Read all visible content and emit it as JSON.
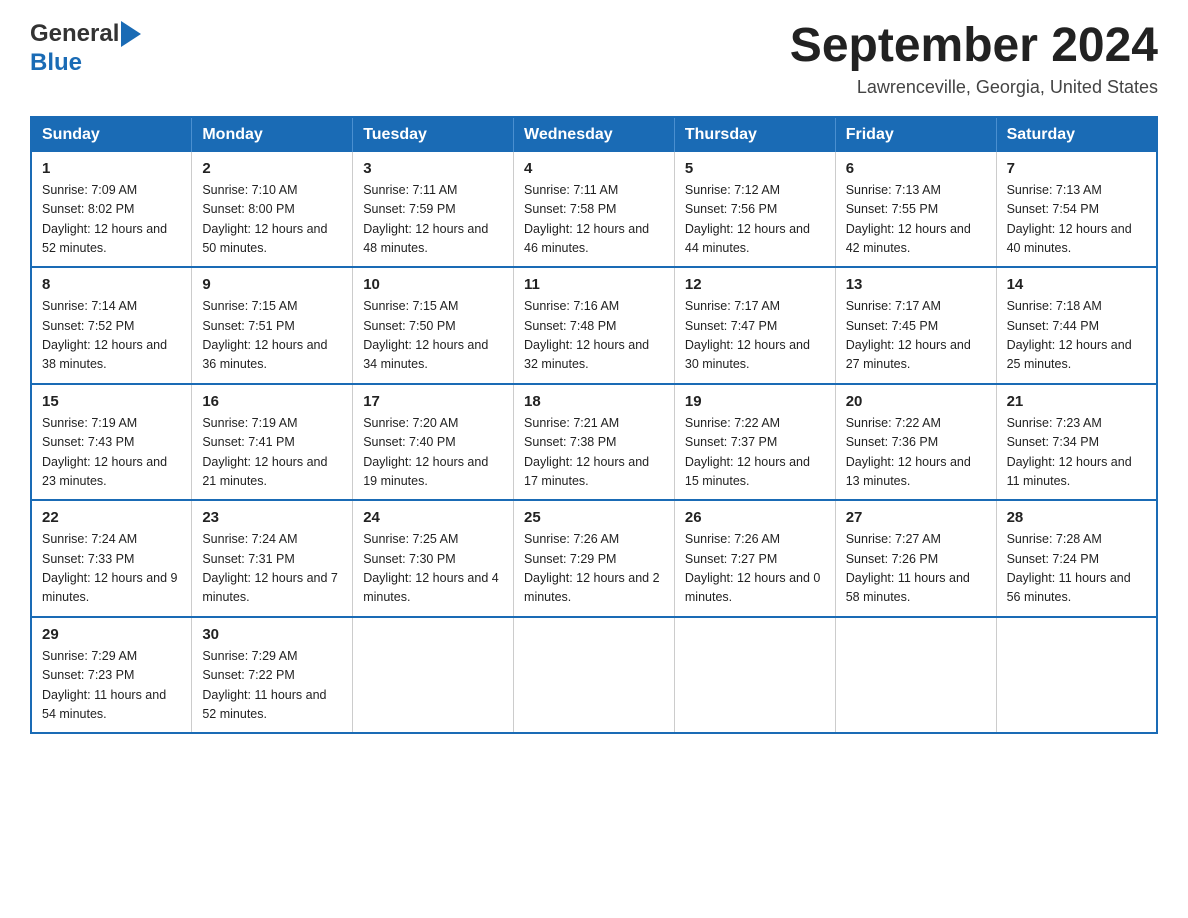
{
  "header": {
    "logo_general": "General",
    "logo_blue": "Blue",
    "title": "September 2024",
    "location": "Lawrenceville, Georgia, United States"
  },
  "weekdays": [
    "Sunday",
    "Monday",
    "Tuesday",
    "Wednesday",
    "Thursday",
    "Friday",
    "Saturday"
  ],
  "weeks": [
    [
      {
        "day": "1",
        "sunrise": "Sunrise: 7:09 AM",
        "sunset": "Sunset: 8:02 PM",
        "daylight": "Daylight: 12 hours and 52 minutes."
      },
      {
        "day": "2",
        "sunrise": "Sunrise: 7:10 AM",
        "sunset": "Sunset: 8:00 PM",
        "daylight": "Daylight: 12 hours and 50 minutes."
      },
      {
        "day": "3",
        "sunrise": "Sunrise: 7:11 AM",
        "sunset": "Sunset: 7:59 PM",
        "daylight": "Daylight: 12 hours and 48 minutes."
      },
      {
        "day": "4",
        "sunrise": "Sunrise: 7:11 AM",
        "sunset": "Sunset: 7:58 PM",
        "daylight": "Daylight: 12 hours and 46 minutes."
      },
      {
        "day": "5",
        "sunrise": "Sunrise: 7:12 AM",
        "sunset": "Sunset: 7:56 PM",
        "daylight": "Daylight: 12 hours and 44 minutes."
      },
      {
        "day": "6",
        "sunrise": "Sunrise: 7:13 AM",
        "sunset": "Sunset: 7:55 PM",
        "daylight": "Daylight: 12 hours and 42 minutes."
      },
      {
        "day": "7",
        "sunrise": "Sunrise: 7:13 AM",
        "sunset": "Sunset: 7:54 PM",
        "daylight": "Daylight: 12 hours and 40 minutes."
      }
    ],
    [
      {
        "day": "8",
        "sunrise": "Sunrise: 7:14 AM",
        "sunset": "Sunset: 7:52 PM",
        "daylight": "Daylight: 12 hours and 38 minutes."
      },
      {
        "day": "9",
        "sunrise": "Sunrise: 7:15 AM",
        "sunset": "Sunset: 7:51 PM",
        "daylight": "Daylight: 12 hours and 36 minutes."
      },
      {
        "day": "10",
        "sunrise": "Sunrise: 7:15 AM",
        "sunset": "Sunset: 7:50 PM",
        "daylight": "Daylight: 12 hours and 34 minutes."
      },
      {
        "day": "11",
        "sunrise": "Sunrise: 7:16 AM",
        "sunset": "Sunset: 7:48 PM",
        "daylight": "Daylight: 12 hours and 32 minutes."
      },
      {
        "day": "12",
        "sunrise": "Sunrise: 7:17 AM",
        "sunset": "Sunset: 7:47 PM",
        "daylight": "Daylight: 12 hours and 30 minutes."
      },
      {
        "day": "13",
        "sunrise": "Sunrise: 7:17 AM",
        "sunset": "Sunset: 7:45 PM",
        "daylight": "Daylight: 12 hours and 27 minutes."
      },
      {
        "day": "14",
        "sunrise": "Sunrise: 7:18 AM",
        "sunset": "Sunset: 7:44 PM",
        "daylight": "Daylight: 12 hours and 25 minutes."
      }
    ],
    [
      {
        "day": "15",
        "sunrise": "Sunrise: 7:19 AM",
        "sunset": "Sunset: 7:43 PM",
        "daylight": "Daylight: 12 hours and 23 minutes."
      },
      {
        "day": "16",
        "sunrise": "Sunrise: 7:19 AM",
        "sunset": "Sunset: 7:41 PM",
        "daylight": "Daylight: 12 hours and 21 minutes."
      },
      {
        "day": "17",
        "sunrise": "Sunrise: 7:20 AM",
        "sunset": "Sunset: 7:40 PM",
        "daylight": "Daylight: 12 hours and 19 minutes."
      },
      {
        "day": "18",
        "sunrise": "Sunrise: 7:21 AM",
        "sunset": "Sunset: 7:38 PM",
        "daylight": "Daylight: 12 hours and 17 minutes."
      },
      {
        "day": "19",
        "sunrise": "Sunrise: 7:22 AM",
        "sunset": "Sunset: 7:37 PM",
        "daylight": "Daylight: 12 hours and 15 minutes."
      },
      {
        "day": "20",
        "sunrise": "Sunrise: 7:22 AM",
        "sunset": "Sunset: 7:36 PM",
        "daylight": "Daylight: 12 hours and 13 minutes."
      },
      {
        "day": "21",
        "sunrise": "Sunrise: 7:23 AM",
        "sunset": "Sunset: 7:34 PM",
        "daylight": "Daylight: 12 hours and 11 minutes."
      }
    ],
    [
      {
        "day": "22",
        "sunrise": "Sunrise: 7:24 AM",
        "sunset": "Sunset: 7:33 PM",
        "daylight": "Daylight: 12 hours and 9 minutes."
      },
      {
        "day": "23",
        "sunrise": "Sunrise: 7:24 AM",
        "sunset": "Sunset: 7:31 PM",
        "daylight": "Daylight: 12 hours and 7 minutes."
      },
      {
        "day": "24",
        "sunrise": "Sunrise: 7:25 AM",
        "sunset": "Sunset: 7:30 PM",
        "daylight": "Daylight: 12 hours and 4 minutes."
      },
      {
        "day": "25",
        "sunrise": "Sunrise: 7:26 AM",
        "sunset": "Sunset: 7:29 PM",
        "daylight": "Daylight: 12 hours and 2 minutes."
      },
      {
        "day": "26",
        "sunrise": "Sunrise: 7:26 AM",
        "sunset": "Sunset: 7:27 PM",
        "daylight": "Daylight: 12 hours and 0 minutes."
      },
      {
        "day": "27",
        "sunrise": "Sunrise: 7:27 AM",
        "sunset": "Sunset: 7:26 PM",
        "daylight": "Daylight: 11 hours and 58 minutes."
      },
      {
        "day": "28",
        "sunrise": "Sunrise: 7:28 AM",
        "sunset": "Sunset: 7:24 PM",
        "daylight": "Daylight: 11 hours and 56 minutes."
      }
    ],
    [
      {
        "day": "29",
        "sunrise": "Sunrise: 7:29 AM",
        "sunset": "Sunset: 7:23 PM",
        "daylight": "Daylight: 11 hours and 54 minutes."
      },
      {
        "day": "30",
        "sunrise": "Sunrise: 7:29 AM",
        "sunset": "Sunset: 7:22 PM",
        "daylight": "Daylight: 11 hours and 52 minutes."
      },
      null,
      null,
      null,
      null,
      null
    ]
  ]
}
